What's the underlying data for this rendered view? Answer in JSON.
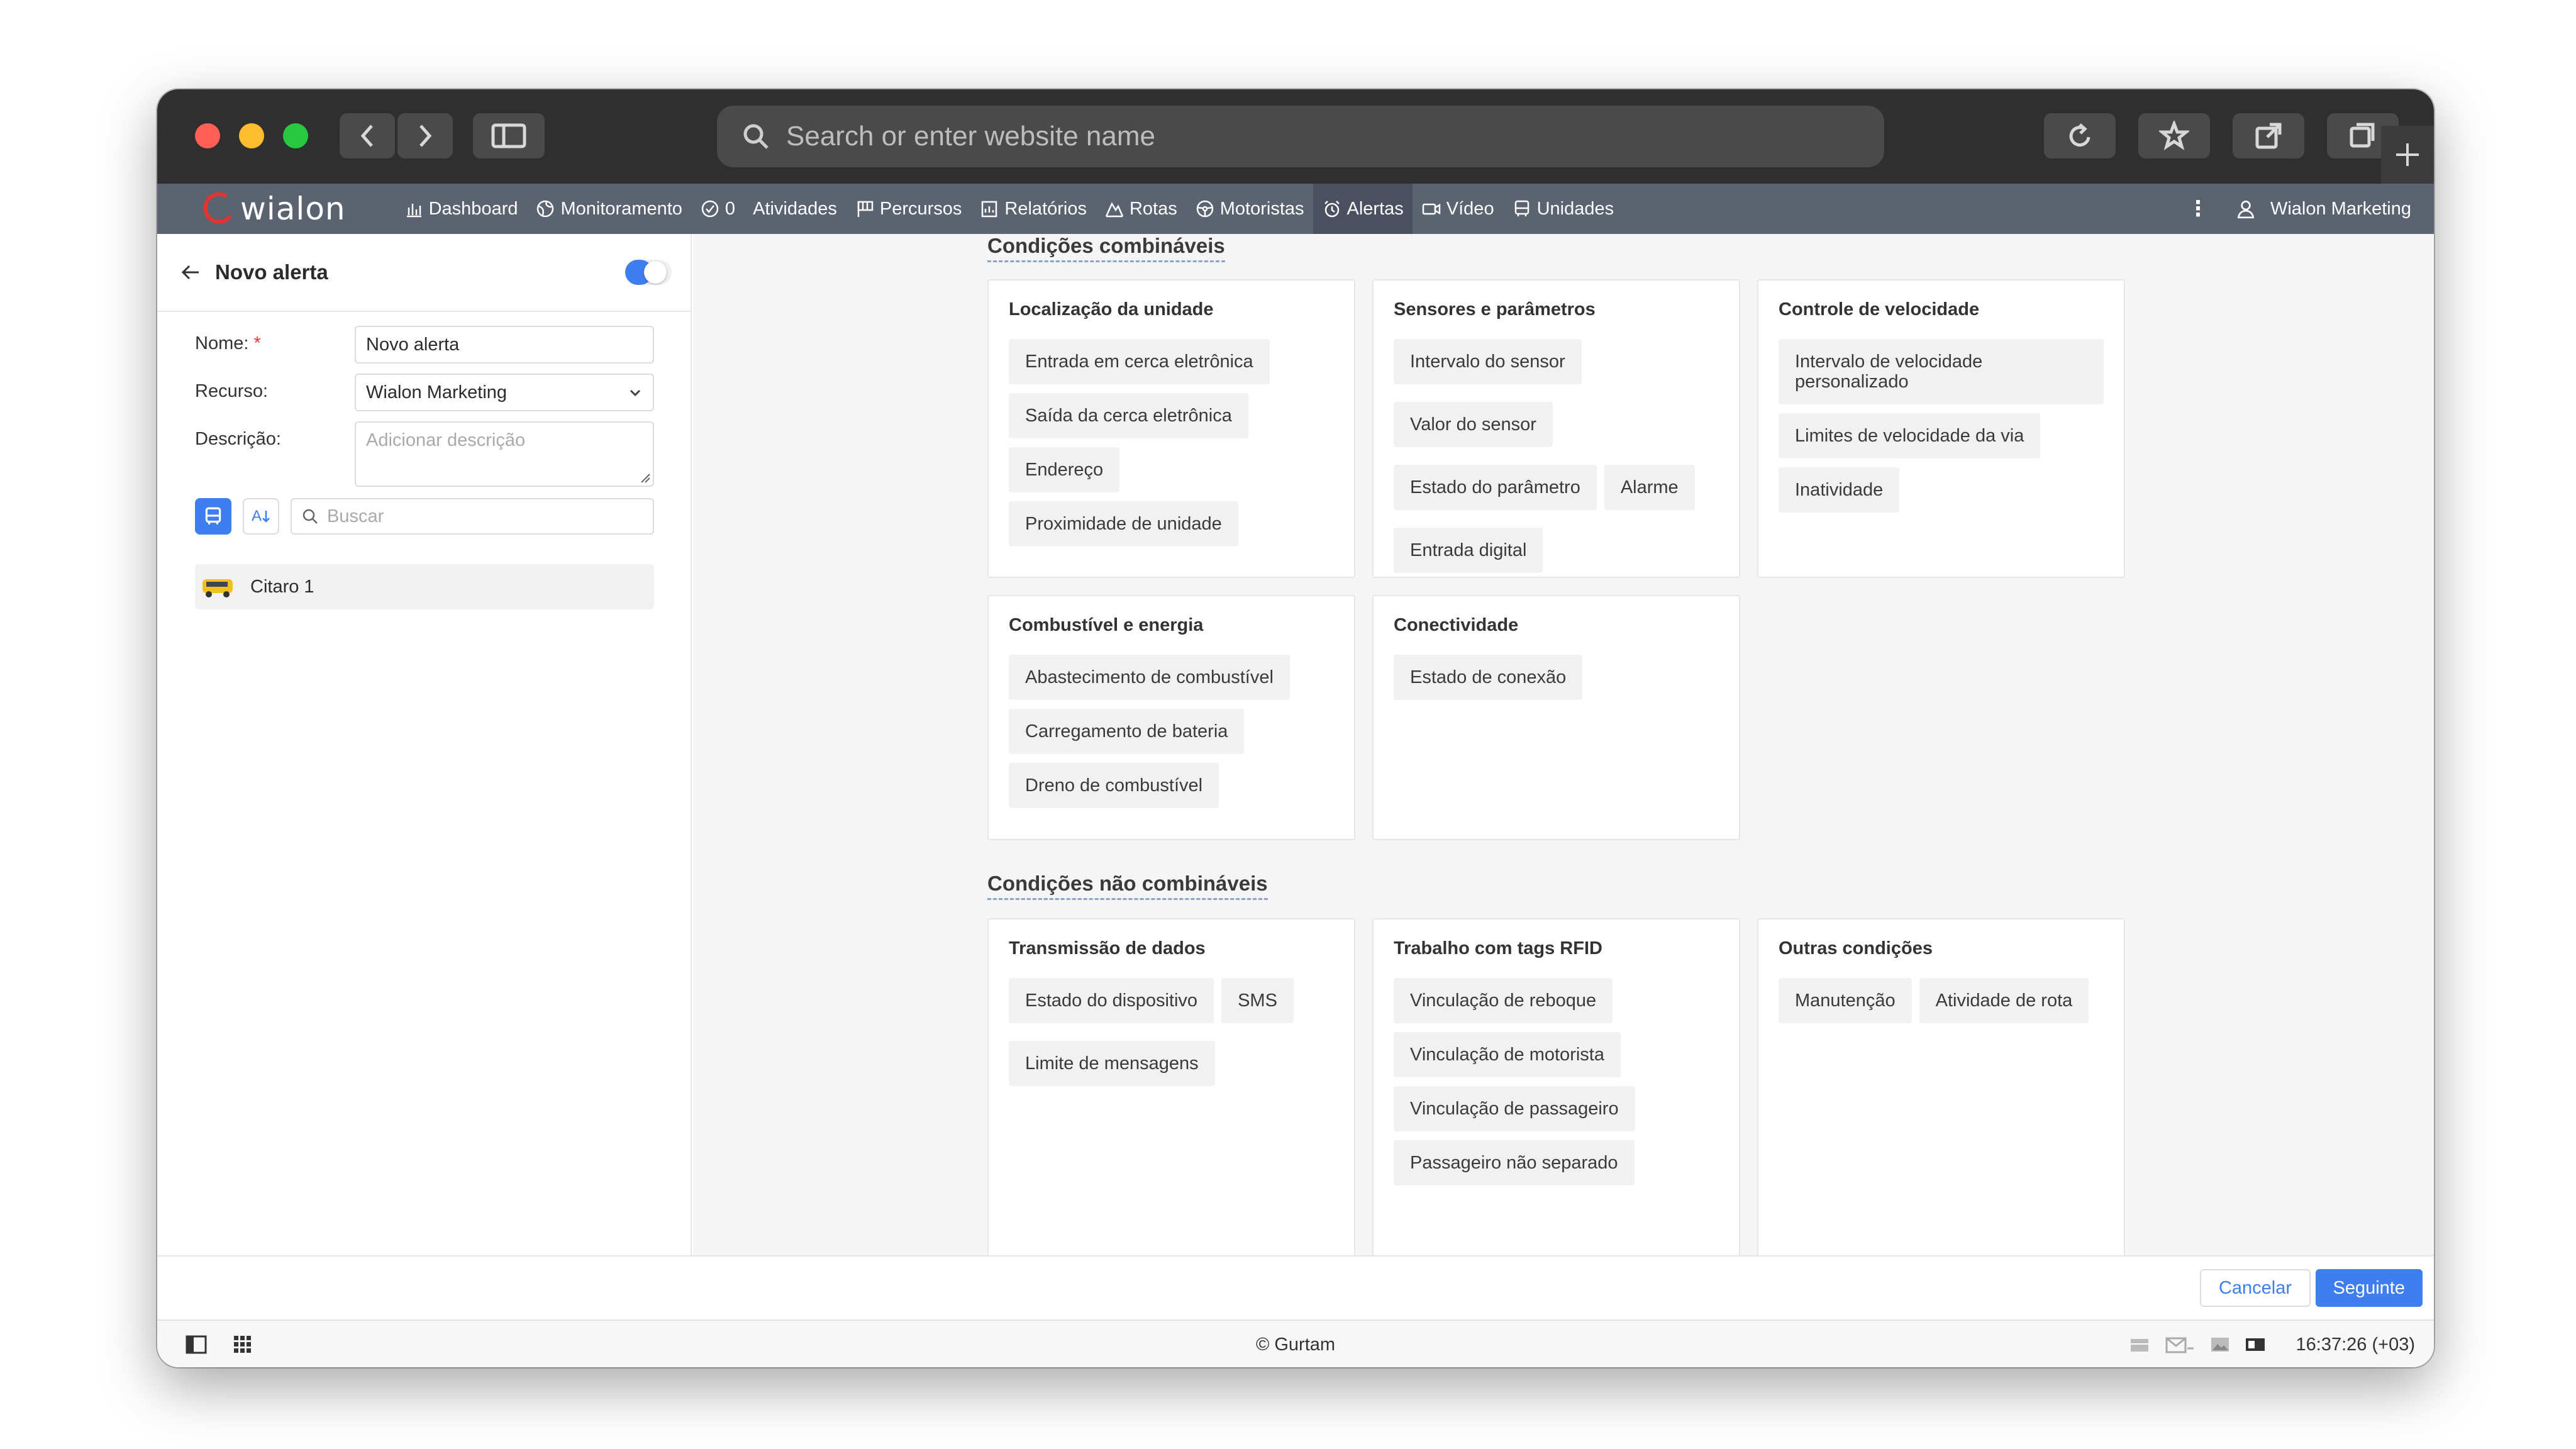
{
  "browser": {
    "address_placeholder": "Search or enter website name"
  },
  "appnav": {
    "logo": "wialon",
    "items": [
      {
        "label": "Dashboard",
        "icon": "chart-icon"
      },
      {
        "label": "Monitoramento",
        "icon": "globe-icon"
      },
      {
        "label": "0",
        "icon": "check-circle-icon"
      },
      {
        "label": "Atividades",
        "icon": ""
      },
      {
        "label": "Percursos",
        "icon": "flag-icon"
      },
      {
        "label": "Relatórios",
        "icon": "report-icon"
      },
      {
        "label": "Rotas",
        "icon": "route-icon"
      },
      {
        "label": "Motoristas",
        "icon": "steering-icon"
      },
      {
        "label": "Alertas",
        "icon": "alarm-icon"
      },
      {
        "label": "Vídeo",
        "icon": "video-icon"
      },
      {
        "label": "Unidades",
        "icon": "bus-icon"
      }
    ],
    "active": "Alertas",
    "user": "Wialon Marketing"
  },
  "sidebar": {
    "title": "Novo alerta",
    "toggle_on": true,
    "name_label": "Nome:",
    "name_required": "*",
    "name_value": "Novo alerta",
    "resource_label": "Recurso:",
    "resource_value": "Wialon Marketing",
    "description_label": "Descrição:",
    "description_placeholder": "Adicionar descrição",
    "sort_label": "A",
    "search_placeholder": "Buscar",
    "units": [
      "Citaro 1"
    ]
  },
  "main": {
    "combinable_title": "Condições combináveis",
    "non_combinable_title": "Condições não combináveis",
    "combinable": [
      {
        "title": "Localização da unidade",
        "items": [
          "Entrada em cerca eletrônica",
          "Saída da cerca eletrônica",
          "Endereço",
          "Proximidade de unidade"
        ]
      },
      {
        "title": "Sensores e parâmetros",
        "items": [
          "Intervalo do sensor",
          "Valor do sensor",
          "Estado do parâmetro",
          "Alarme",
          "Entrada digital"
        ]
      },
      {
        "title": "Controle de velocidade",
        "items": [
          "Intervalo de velocidade personalizado",
          "Limites de velocidade da via",
          "Inatividade"
        ]
      },
      {
        "title": "Combustível e energia",
        "items": [
          "Abastecimento de combustível",
          "Carregamento de bateria",
          "Dreno de combustível"
        ]
      },
      {
        "title": "Conectividade",
        "items": [
          "Estado de conexão"
        ]
      }
    ],
    "non_combinable": [
      {
        "title": "Transmissão de dados",
        "items": [
          "Estado do dispositivo",
          "SMS",
          "Limite de mensagens"
        ]
      },
      {
        "title": "Trabalho com tags RFID",
        "items": [
          "Vinculação de reboque",
          "Vinculação de motorista",
          "Vinculação de passageiro",
          "Passageiro não separado"
        ]
      },
      {
        "title": "Outras condições",
        "items": [
          "Manutenção",
          "Atividade de rota"
        ]
      }
    ]
  },
  "actions": {
    "cancel": "Cancelar",
    "next": "Seguinte"
  },
  "statusbar": {
    "copyright": "© Gurtam",
    "time": "16:37:26 (+03)"
  },
  "colors": {
    "accent": "#3d7ff0",
    "nav_bg": "#5b6270",
    "logo_red": "#e3342f"
  }
}
